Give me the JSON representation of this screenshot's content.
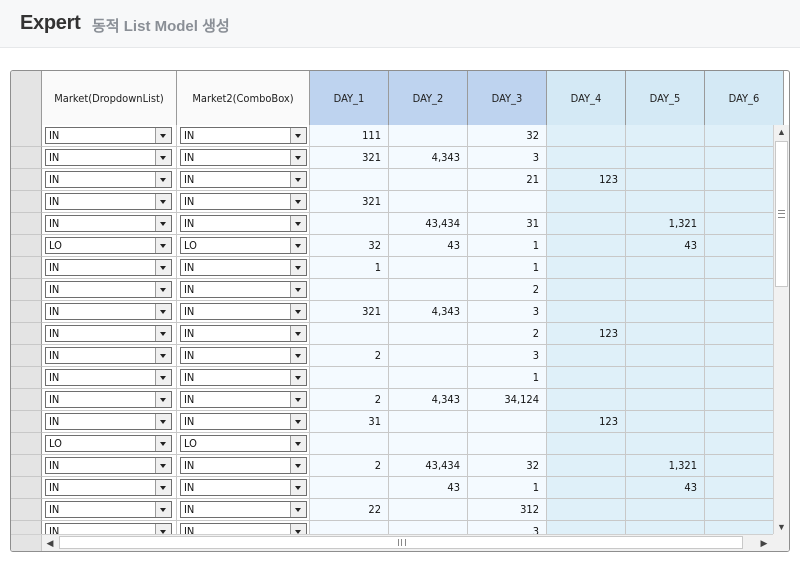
{
  "header": {
    "brand": "Expert",
    "subtitle": "동적 List Model 생성"
  },
  "grid": {
    "columns": [
      {
        "key": "market",
        "label": "Market(DropdownList)"
      },
      {
        "key": "market2",
        "label": "Market2(ComboBox)"
      },
      {
        "key": "d1",
        "label": "DAY_1"
      },
      {
        "key": "d2",
        "label": "DAY_2"
      },
      {
        "key": "d3",
        "label": "DAY_3"
      },
      {
        "key": "d4",
        "label": "DAY_4"
      },
      {
        "key": "d5",
        "label": "DAY_5"
      },
      {
        "key": "d6",
        "label": "DAY_6"
      }
    ],
    "rows": [
      {
        "market": "IN",
        "market2": "IN",
        "d1": "111",
        "d2": "",
        "d3": "32",
        "d4": "",
        "d5": "",
        "d6": ""
      },
      {
        "market": "IN",
        "market2": "IN",
        "d1": "321",
        "d2": "4,343",
        "d3": "3",
        "d4": "",
        "d5": "",
        "d6": ""
      },
      {
        "market": "IN",
        "market2": "IN",
        "d1": "",
        "d2": "",
        "d3": "21",
        "d4": "123",
        "d5": "",
        "d6": ""
      },
      {
        "market": "IN",
        "market2": "IN",
        "d1": "321",
        "d2": "",
        "d3": "",
        "d4": "",
        "d5": "",
        "d6": ""
      },
      {
        "market": "IN",
        "market2": "IN",
        "d1": "",
        "d2": "43,434",
        "d3": "31",
        "d4": "",
        "d5": "1,321",
        "d6": ""
      },
      {
        "market": "LO",
        "market2": "LO",
        "d1": "32",
        "d2": "43",
        "d3": "1",
        "d4": "",
        "d5": "43",
        "d6": ""
      },
      {
        "market": "IN",
        "market2": "IN",
        "d1": "1",
        "d2": "",
        "d3": "1",
        "d4": "",
        "d5": "",
        "d6": ""
      },
      {
        "market": "IN",
        "market2": "IN",
        "d1": "",
        "d2": "",
        "d3": "2",
        "d4": "",
        "d5": "",
        "d6": ""
      },
      {
        "market": "IN",
        "market2": "IN",
        "d1": "321",
        "d2": "4,343",
        "d3": "3",
        "d4": "",
        "d5": "",
        "d6": ""
      },
      {
        "market": "IN",
        "market2": "IN",
        "d1": "",
        "d2": "",
        "d3": "2",
        "d4": "123",
        "d5": "",
        "d6": ""
      },
      {
        "market": "IN",
        "market2": "IN",
        "d1": "2",
        "d2": "",
        "d3": "3",
        "d4": "",
        "d5": "",
        "d6": ""
      },
      {
        "market": "IN",
        "market2": "IN",
        "d1": "",
        "d2": "",
        "d3": "1",
        "d4": "",
        "d5": "",
        "d6": ""
      },
      {
        "market": "IN",
        "market2": "IN",
        "d1": "2",
        "d2": "4,343",
        "d3": "34,124",
        "d4": "",
        "d5": "",
        "d6": ""
      },
      {
        "market": "IN",
        "market2": "IN",
        "d1": "31",
        "d2": "",
        "d3": "",
        "d4": "123",
        "d5": "",
        "d6": ""
      },
      {
        "market": "LO",
        "market2": "LO",
        "d1": "",
        "d2": "",
        "d3": "",
        "d4": "",
        "d5": "",
        "d6": ""
      },
      {
        "market": "IN",
        "market2": "IN",
        "d1": "2",
        "d2": "43,434",
        "d3": "32",
        "d4": "",
        "d5": "1,321",
        "d6": ""
      },
      {
        "market": "IN",
        "market2": "IN",
        "d1": "",
        "d2": "43",
        "d3": "1",
        "d4": "",
        "d5": "43",
        "d6": ""
      },
      {
        "market": "IN",
        "market2": "IN",
        "d1": "22",
        "d2": "",
        "d3": "312",
        "d4": "",
        "d5": "",
        "d6": ""
      },
      {
        "market": "IN",
        "market2": "IN",
        "d1": "",
        "d2": "",
        "d3": "3",
        "d4": "",
        "d5": "",
        "d6": ""
      }
    ]
  },
  "scrollbars": {
    "up_icon": "▲",
    "down_icon": "▼",
    "left_icon": "◀",
    "right_icon": "▶"
  }
}
